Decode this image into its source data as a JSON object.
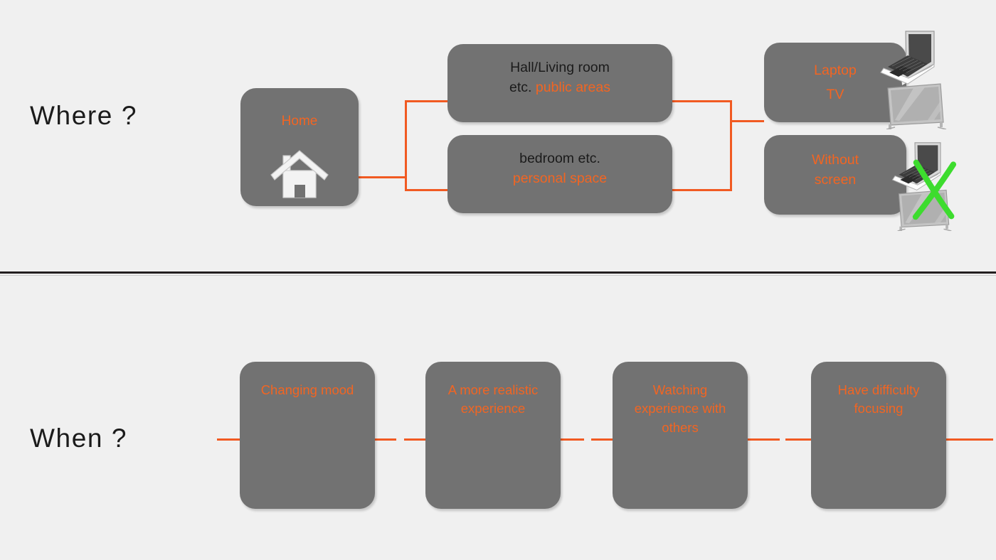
{
  "slide": {
    "background_color": "#f0f0f0",
    "accent_color": "#f26522",
    "card_color": "#727272",
    "cross_color": "#3ddc2e",
    "divider_color": "#231f20"
  },
  "sections": {
    "where": {
      "question": "Where ?",
      "home": {
        "label": "Home",
        "icon": "house-icon"
      },
      "rooms": [
        {
          "label_primary": "Hall/Living room",
          "label_secondary_prefix": "etc. ",
          "label_accent": "public areas"
        },
        {
          "label_primary": "bedroom etc.",
          "label_accent": "personal space"
        }
      ],
      "devices": {
        "lines": [
          "Laptop",
          "TV"
        ],
        "icons": [
          "laptop-icon",
          "tv-icon"
        ]
      },
      "without_screen": {
        "lines": [
          "Without",
          "screen"
        ],
        "icons": [
          "laptop-icon",
          "tv-icon",
          "green-cross-icon"
        ]
      }
    },
    "when": {
      "question": "When ?",
      "cards": [
        {
          "label": "Changing mood"
        },
        {
          "label": "A more realistic experience"
        },
        {
          "label": "Watching experience with others"
        },
        {
          "label": "Have difficulty focusing"
        }
      ]
    }
  }
}
